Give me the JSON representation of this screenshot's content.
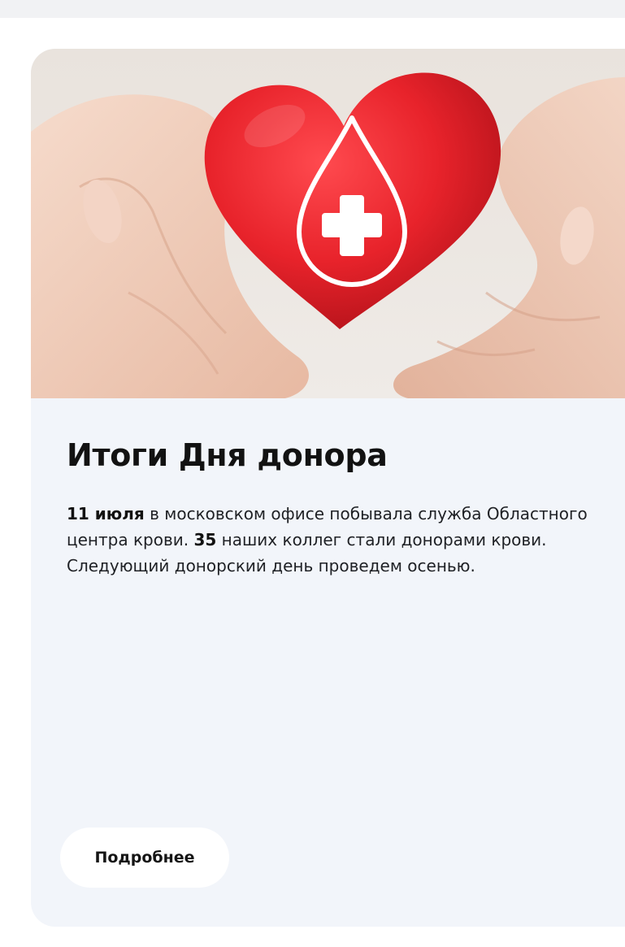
{
  "card": {
    "title": "Итоги Дня донора",
    "text": {
      "date": "11 июля",
      "part1": " в московском офисе побывала служба Областного центра крови. ",
      "count": "35",
      "part2": " наших коллег стали донорами крови. Следующий донорский день проведем осенью."
    },
    "button_label": "Подробнее"
  },
  "image": {
    "icon": "blood-drop-cross-icon",
    "heart_color": "#e8232b",
    "symbol_color": "#ffffff"
  }
}
